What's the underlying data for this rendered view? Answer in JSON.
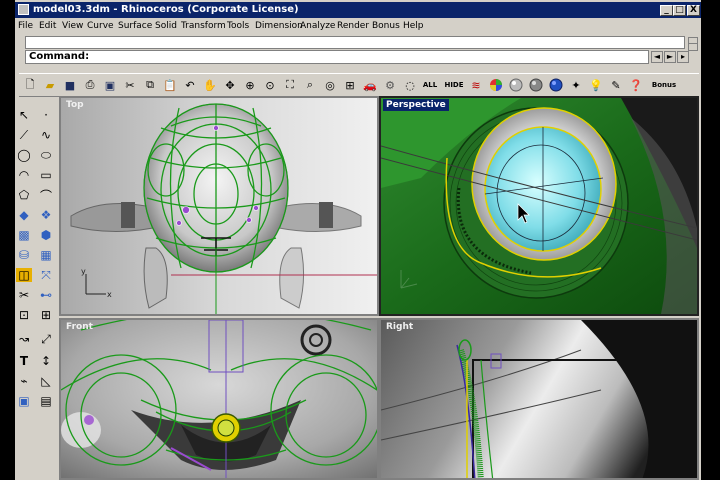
{
  "window": {
    "title": "model03.3dm - Rhinoceros (Corporate License)",
    "min_label": "_",
    "max_label": "□",
    "close_label": "X"
  },
  "menu": [
    "File",
    "Edit",
    "View",
    "Curve",
    "Surface",
    "Solid",
    "Transform",
    "Tools",
    "Dimension",
    "Analyze",
    "Render",
    "Bonus",
    "Help"
  ],
  "command": {
    "prompt": "Command:",
    "value": ""
  },
  "toolbar": {
    "all_label": "ALL",
    "hide_label": "HIDE",
    "bonus_label": "Bonus"
  },
  "viewports": {
    "top": "Top",
    "perspective": "Perspective",
    "front": "Front",
    "right": "Right"
  },
  "axes": {
    "x": "x",
    "y": "y"
  },
  "icons": [
    "new-icon",
    "open-icon",
    "save-icon",
    "print-icon",
    "save-as-icon",
    "cut-icon",
    "copy-icon",
    "paste-icon",
    "undo-icon",
    "pan-hand-icon",
    "rotate-view-icon",
    "zoom-window-icon",
    "zoom-extents-icon",
    "zoom-selected-icon",
    "zoom-icon",
    "four-viewports-icon",
    "car-icon",
    "gear-icon",
    "layer-icon",
    "color-wheel-icon",
    "sphere-icon",
    "globe-icon",
    "render-icon",
    "light-icon",
    "help-icon"
  ]
}
